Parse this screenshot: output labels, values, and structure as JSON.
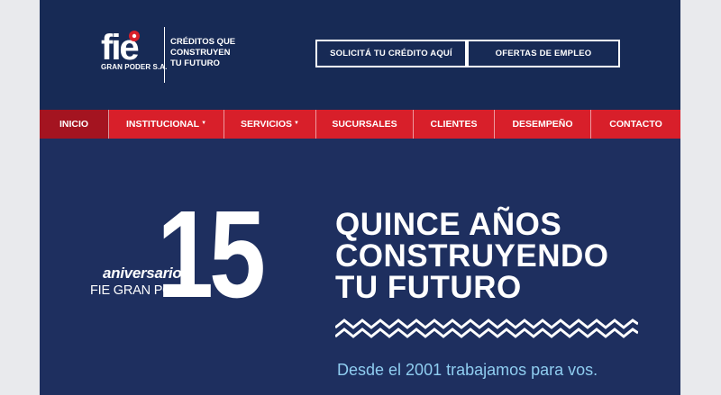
{
  "header": {
    "logo": {
      "mark": "fie",
      "subtitle": "GRAN PODER S.A.",
      "tagline": [
        "CRÉDITOS QUE",
        "CONSTRUYEN",
        "TU FUTURO"
      ]
    },
    "buttons": {
      "credit": "SOLICITÁ TU CRÉDITO AQUÍ",
      "jobs": "OFERTAS DE EMPLEO"
    }
  },
  "nav": {
    "items": [
      {
        "label": "INICIO",
        "active": true
      },
      {
        "label": "INSTITUCIONAL",
        "dropdown": true
      },
      {
        "label": "SERVICIOS",
        "dropdown": true
      },
      {
        "label": "SUCURSALES"
      },
      {
        "label": "CLIENTES"
      },
      {
        "label": "DESEMPEÑO"
      },
      {
        "label": "CONTACTO"
      }
    ]
  },
  "hero": {
    "number": "15",
    "aniversario": "aniversario",
    "org": "FIE GRAN PODER",
    "headline": [
      "QUINCE AÑOS",
      "CONSTRUYENDO",
      "TU FUTURO"
    ],
    "subline": "Desde el 2001 trabajamos para vos."
  },
  "colors": {
    "header_bg": "#172a55",
    "hero_bg": "#1e2f5f",
    "nav_red": "#d81f2a",
    "nav_active": "#a41420",
    "subline": "#8fcdf0"
  }
}
